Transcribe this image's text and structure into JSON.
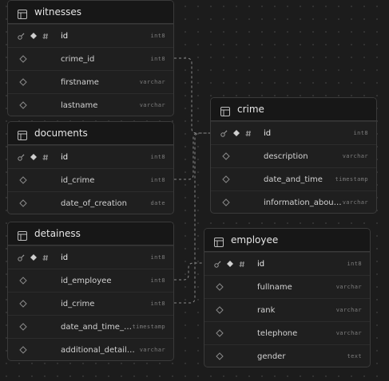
{
  "tables": {
    "witnesses": {
      "name": "witnesses",
      "columns": [
        {
          "name": "id",
          "type": "int8"
        },
        {
          "name": "crime_id",
          "type": "int8"
        },
        {
          "name": "firstname",
          "type": "varchar"
        },
        {
          "name": "lastname",
          "type": "varchar"
        }
      ]
    },
    "documents": {
      "name": "documents",
      "columns": [
        {
          "name": "id",
          "type": "int8"
        },
        {
          "name": "id_crime",
          "type": "int8"
        },
        {
          "name": "date_of_creation",
          "type": "date"
        }
      ]
    },
    "detainess": {
      "name": "detainess",
      "columns": [
        {
          "name": "id",
          "type": "int8"
        },
        {
          "name": "id_employee",
          "type": "int8"
        },
        {
          "name": "id_crime",
          "type": "int8"
        },
        {
          "name": "date_and_time_of_de...",
          "type": "timestamp"
        },
        {
          "name": "additional_detailess_...",
          "type": "varchar"
        }
      ]
    },
    "crime": {
      "name": "crime",
      "columns": [
        {
          "name": "id",
          "type": "int8"
        },
        {
          "name": "description",
          "type": "varchar"
        },
        {
          "name": "date_and_time",
          "type": "timestamp"
        },
        {
          "name": "information_about_t...",
          "type": "varchar"
        }
      ]
    },
    "employee": {
      "name": "employee",
      "columns": [
        {
          "name": "id",
          "type": "int8"
        },
        {
          "name": "fullname",
          "type": "varchar"
        },
        {
          "name": "rank",
          "type": "varchar"
        },
        {
          "name": "telephone",
          "type": "varchar"
        },
        {
          "name": "gender",
          "type": "text"
        }
      ]
    }
  },
  "icons": {
    "table": "table-grid-icon",
    "primary_key": "key-icon",
    "identity": "diamond-icon",
    "unique": "hash-icon",
    "nullable": "hollow-diamond-icon"
  },
  "colors": {
    "canvas": "#1c1c1c",
    "card": "#1f1f1f",
    "header": "#171717",
    "border": "#3a3a3a",
    "edge": "#8a8a8a"
  }
}
